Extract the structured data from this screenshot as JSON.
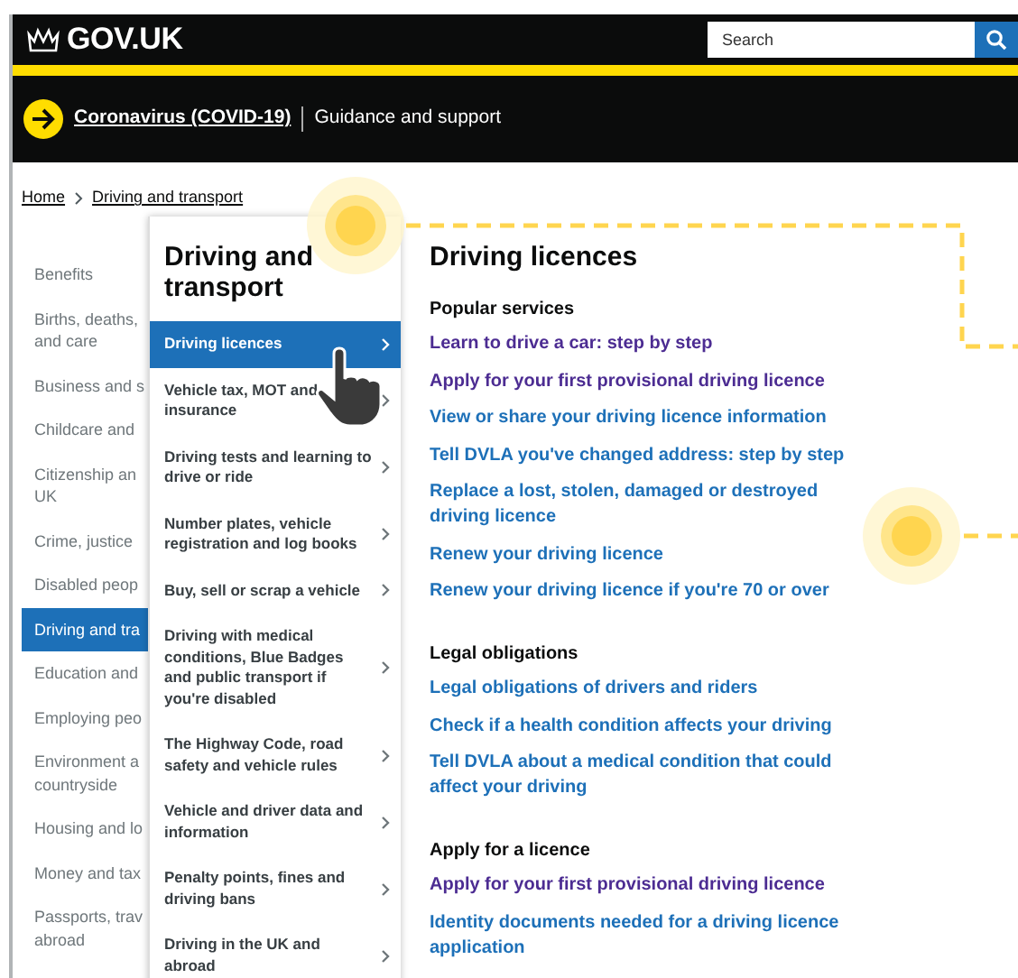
{
  "header": {
    "logo": "GOV.UK",
    "search": {
      "placeholder": "Search"
    }
  },
  "banner": {
    "link": "Coronavirus (COVID-19)",
    "text": "Guidance and support"
  },
  "breadcrumbs": [
    {
      "label": "Home"
    },
    {
      "label": "Driving and transport"
    }
  ],
  "categories": [
    {
      "label": "Benefits",
      "selected": false
    },
    {
      "label": "Births, deaths,\nand care",
      "selected": false
    },
    {
      "label": "Business and s",
      "selected": false
    },
    {
      "label": "Childcare and",
      "selected": false
    },
    {
      "label": "Citizenship an\nUK",
      "selected": false
    },
    {
      "label": "Crime, justice",
      "selected": false
    },
    {
      "label": "Disabled peop",
      "selected": false
    },
    {
      "label": "Driving and tra",
      "selected": true
    },
    {
      "label": "Education and",
      "selected": false
    },
    {
      "label": "Employing peo",
      "selected": false
    },
    {
      "label": "Environment a\ncountryside",
      "selected": false
    },
    {
      "label": "Housing and lo",
      "selected": false
    },
    {
      "label": "Money and tax",
      "selected": false
    },
    {
      "label": "Passports, trav\nabroad",
      "selected": false
    }
  ],
  "subnav": {
    "title": "Driving and transport",
    "items": [
      {
        "label": "Driving licences",
        "selected": true
      },
      {
        "label": "Vehicle tax, MOT and insurance",
        "selected": false
      },
      {
        "label": "Driving tests and learning to drive or ride",
        "selected": false
      },
      {
        "label": "Number plates, vehicle registration and log books",
        "selected": false
      },
      {
        "label": "Buy, sell or scrap a vehicle",
        "selected": false
      },
      {
        "label": "Driving with medical conditions, Blue Badges and public transport if you're disabled",
        "selected": false
      },
      {
        "label": "The Highway Code, road safety and vehicle rules",
        "selected": false
      },
      {
        "label": "Vehicle and driver data and information",
        "selected": false
      },
      {
        "label": "Penalty points, fines and driving bans",
        "selected": false
      },
      {
        "label": "Driving in the UK and abroad",
        "selected": false
      }
    ]
  },
  "content": {
    "title": "Driving licences",
    "sections": [
      {
        "heading": "Popular services",
        "links": [
          {
            "label": "Learn to drive a car: step by step",
            "visited": true
          },
          {
            "label": "Apply for your first provisional driving licence",
            "visited": true
          },
          {
            "label": "View or share your driving licence information",
            "visited": false
          },
          {
            "label": "Tell DVLA you've changed address: step by step",
            "visited": false
          },
          {
            "label": "Replace a lost, stolen, damaged or destroyed driving licence",
            "visited": false
          },
          {
            "label": "Renew your driving licence",
            "visited": false
          },
          {
            "label": "Renew your driving licence if you're 70 or over",
            "visited": false
          }
        ]
      },
      {
        "heading": "Legal obligations",
        "links": [
          {
            "label": "Legal obligations of drivers and riders",
            "visited": false
          },
          {
            "label": "Check if a health condition affects your driving",
            "visited": false
          },
          {
            "label": "Tell DVLA about a medical condition that could affect your driving",
            "visited": false
          }
        ]
      },
      {
        "heading": "Apply for a licence",
        "links": [
          {
            "label": "Apply for your first provisional driving licence",
            "visited": true
          },
          {
            "label": "Identity documents needed for a driving licence application",
            "visited": false
          }
        ]
      }
    ]
  }
}
